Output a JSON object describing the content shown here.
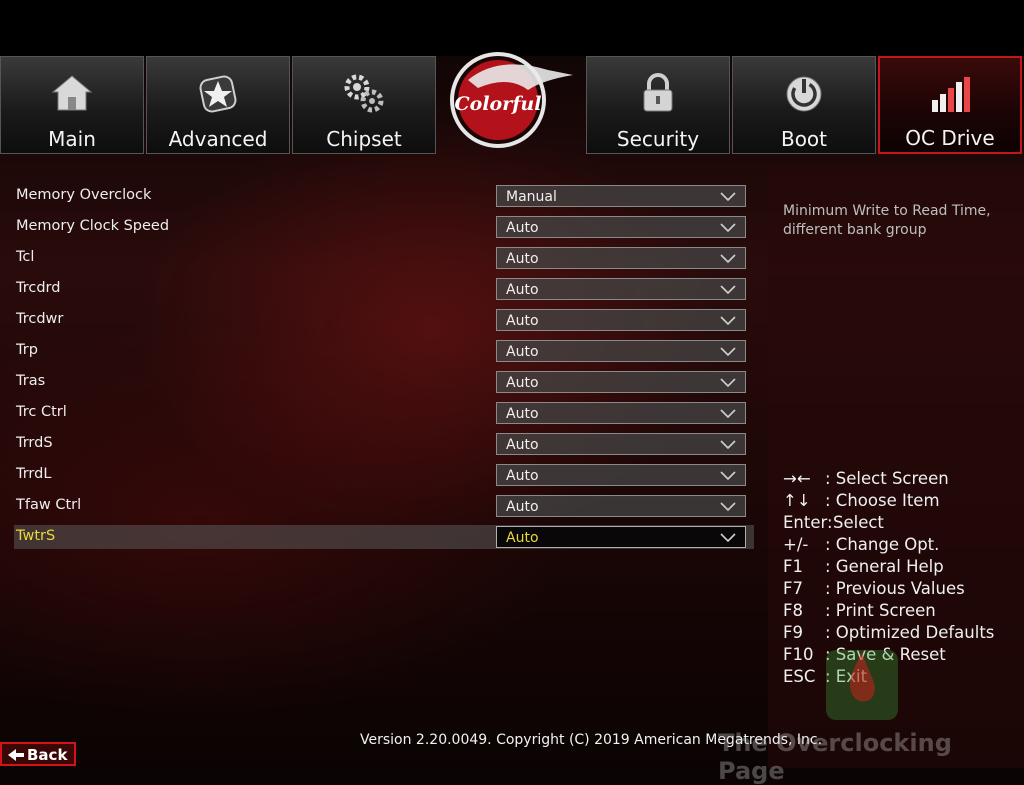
{
  "tabs": [
    {
      "label": "Main",
      "icon": "home-icon"
    },
    {
      "label": "Advanced",
      "icon": "advanced-star-icon"
    },
    {
      "label": "Chipset",
      "icon": "gears-icon"
    },
    {
      "label": "Security",
      "icon": "lock-icon"
    },
    {
      "label": "Boot",
      "icon": "power-icon"
    },
    {
      "label": "OC Drive",
      "icon": "bar-chart-icon"
    }
  ],
  "active_tab": "OC Drive",
  "logo": {
    "text": "Colorful"
  },
  "settings": [
    {
      "label": "Memory Overclock",
      "value": "Manual"
    },
    {
      "label": "Memory Clock Speed",
      "value": "Auto"
    },
    {
      "label": "Tcl",
      "value": "Auto"
    },
    {
      "label": "Trcdrd",
      "value": "Auto"
    },
    {
      "label": "Trcdwr",
      "value": "Auto"
    },
    {
      "label": "Trp",
      "value": "Auto"
    },
    {
      "label": "Tras",
      "value": "Auto"
    },
    {
      "label": "Trc Ctrl",
      "value": "Auto"
    },
    {
      "label": "TrrdS",
      "value": "Auto"
    },
    {
      "label": "TrrdL",
      "value": "Auto"
    },
    {
      "label": "Tfaw Ctrl",
      "value": "Auto"
    },
    {
      "label": "TwtrS",
      "value": "Auto"
    }
  ],
  "selected_setting": "TwtrS",
  "help_text": "Minimum Write to Read Time, different bank group",
  "key_help": [
    {
      "key": "→←",
      "desc": ": Select Screen"
    },
    {
      "key": "↑↓",
      "desc": ": Choose Item"
    },
    {
      "key": "Enter:",
      "desc": "Select"
    },
    {
      "key": "+/-",
      "desc": ": Change Opt."
    },
    {
      "key": "F1",
      "desc": ": General Help"
    },
    {
      "key": "F7",
      "desc": ": Previous Values"
    },
    {
      "key": "F8",
      "desc": ": Print Screen"
    },
    {
      "key": "F9",
      "desc": ": Optimized Defaults"
    },
    {
      "key": "F10",
      "desc": ": Save & Reset"
    },
    {
      "key": "ESC",
      "desc": ": Exit"
    }
  ],
  "version": "Version 2.20.0049. Copyright (C) 2019 American Megatrends, Inc.",
  "watermark": "The Overclocking Page",
  "back_label": "Back",
  "colors": {
    "accent": "#c0161c",
    "selected_text": "#e8d83a"
  }
}
